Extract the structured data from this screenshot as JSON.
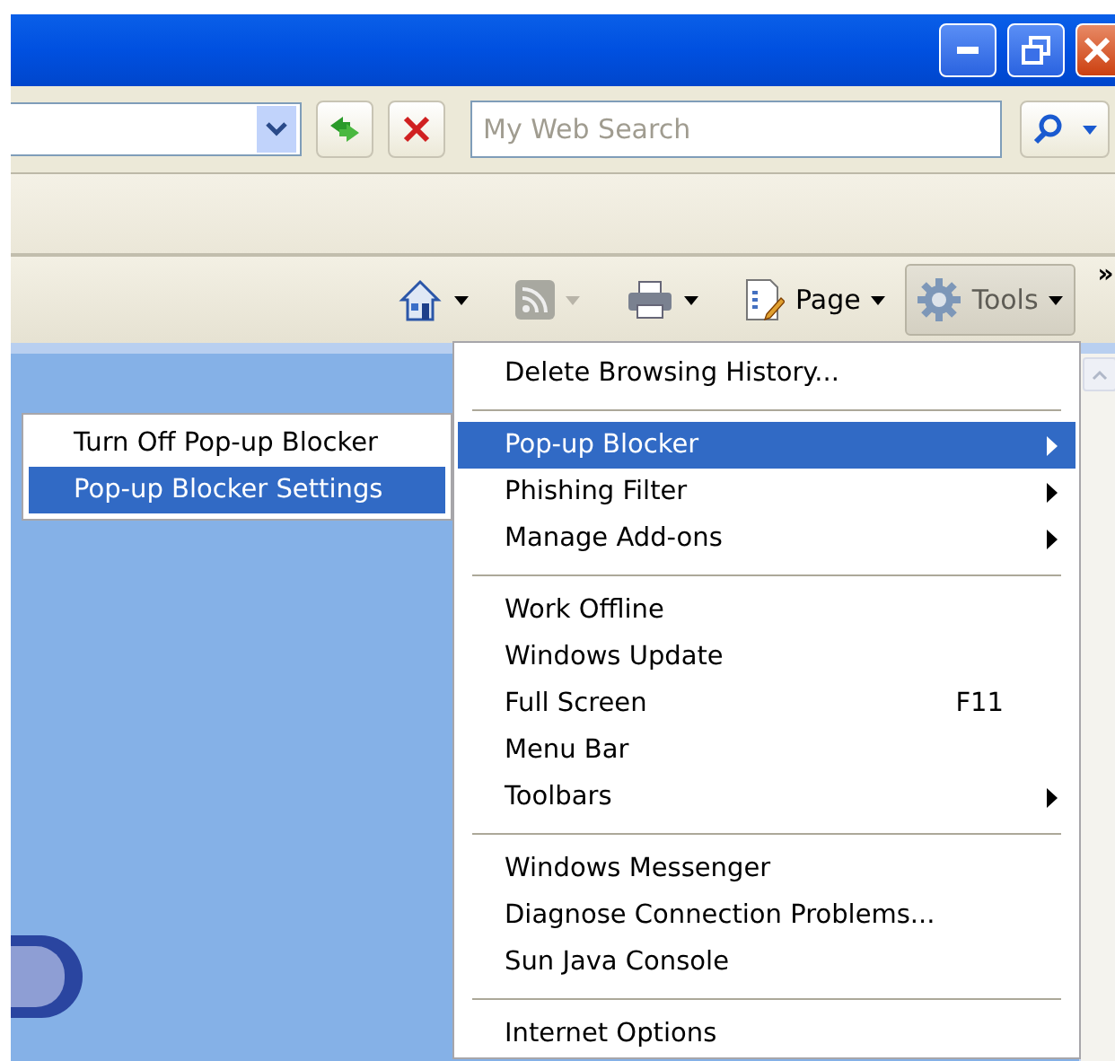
{
  "search_bar": {
    "placeholder": "My Web Search"
  },
  "command_bar": {
    "items": [
      {
        "kind": "home",
        "disabled": false,
        "selected": false
      },
      {
        "kind": "feeds",
        "disabled": true,
        "selected": false
      },
      {
        "kind": "print",
        "disabled": false,
        "selected": false
      },
      {
        "kind": "page",
        "label": "Page",
        "disabled": false,
        "selected": false
      },
      {
        "kind": "tools",
        "label": "Tools",
        "disabled": false,
        "selected": true
      }
    ],
    "overflow": "»"
  },
  "tools_menu": {
    "items": [
      {
        "kind": "item",
        "label": "Delete Browsing History...",
        "selected": false,
        "submenu": false
      },
      {
        "kind": "separator"
      },
      {
        "kind": "item",
        "label": "Pop-up Blocker",
        "selected": true,
        "submenu": true
      },
      {
        "kind": "item",
        "label": "Phishing Filter",
        "selected": false,
        "submenu": true
      },
      {
        "kind": "item",
        "label": "Manage Add-ons",
        "selected": false,
        "submenu": true
      },
      {
        "kind": "separator"
      },
      {
        "kind": "item",
        "label": "Work Offline",
        "selected": false,
        "submenu": false
      },
      {
        "kind": "item",
        "label": "Windows Update",
        "selected": false,
        "submenu": false
      },
      {
        "kind": "item",
        "label": "Full Screen",
        "shortcut": "F11",
        "selected": false,
        "submenu": false
      },
      {
        "kind": "item",
        "label": "Menu Bar",
        "selected": false,
        "submenu": false
      },
      {
        "kind": "item",
        "label": "Toolbars",
        "selected": false,
        "submenu": true
      },
      {
        "kind": "separator"
      },
      {
        "kind": "item",
        "label": "Windows Messenger",
        "selected": false,
        "submenu": false
      },
      {
        "kind": "item",
        "label": "Diagnose Connection Problems...",
        "selected": false,
        "submenu": false
      },
      {
        "kind": "item",
        "label": "Sun Java Console",
        "selected": false,
        "submenu": false
      },
      {
        "kind": "separator"
      },
      {
        "kind": "item",
        "label": "Internet Options",
        "selected": false,
        "submenu": false
      }
    ]
  },
  "popup_submenu": {
    "items": [
      {
        "label": "Turn Off Pop-up Blocker",
        "selected": false
      },
      {
        "label": "Pop-up Blocker Settings",
        "selected": true
      }
    ]
  }
}
